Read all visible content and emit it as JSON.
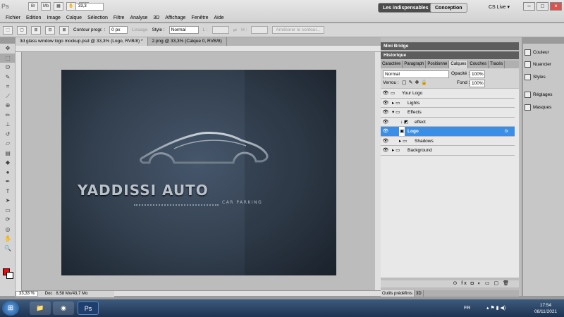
{
  "app": {
    "logo": "Ps",
    "zoom": "33,3",
    "workspace_buttons": [
      "Les indispensables",
      "Conception"
    ],
    "cs_live": "CS Live ▾"
  },
  "menu": [
    "Fichier",
    "Edition",
    "Image",
    "Calque",
    "Sélection",
    "Filtre",
    "Analyse",
    "3D",
    "Affichage",
    "Fenêtre",
    "Aide"
  ],
  "options": {
    "contour_label": "Contour progr. :",
    "contour_value": "0 px",
    "lissage": "Lissage",
    "style_label": "Style :",
    "style_value": "Normal",
    "L_label": "L :",
    "H_label": "H :",
    "refine": "Améliorer le contour..."
  },
  "doc_tabs": [
    "3d glass window logo mockup.psd @ 33,3% (Logo, RVB/8) *",
    "2.png @ 33,3% (Calque 0, RVB/8)"
  ],
  "status": {
    "zoom": "33,33 %",
    "doc": "Doc : 8,58 Mo/43,7 Mo"
  },
  "artwork": {
    "title": "YADDISSI AUTO",
    "subtitle": "CAR PARKING"
  },
  "panels": {
    "mini_bridge": "Mini Bridge",
    "historique": "Historique",
    "tabs": [
      "Caractère",
      "Paragraph",
      "Positionne",
      "Calques",
      "Couches",
      "Tracés"
    ],
    "blend_mode": "Normal",
    "opacity_label": "Opacité :",
    "opacity_value": "100%",
    "lock_label": "Verrou :",
    "fill_label": "Fond :",
    "fill_value": "100%",
    "layers": [
      "Your Logo",
      "Lights",
      "Effects",
      "effect",
      "Logo",
      "Shadows",
      "Background"
    ],
    "bottom_tabs": [
      "Outils prédéfinis",
      "3D"
    ]
  },
  "dock": [
    "Couleur",
    "Nuancier",
    "Styles",
    "Réglages",
    "Masques"
  ],
  "taskbar": {
    "lang": "FR",
    "time": "17:54",
    "date": "08/11/2021"
  },
  "colors": {
    "foreground": "#ff0000",
    "background": "#ffffff",
    "selection": "#3a8ee6"
  }
}
